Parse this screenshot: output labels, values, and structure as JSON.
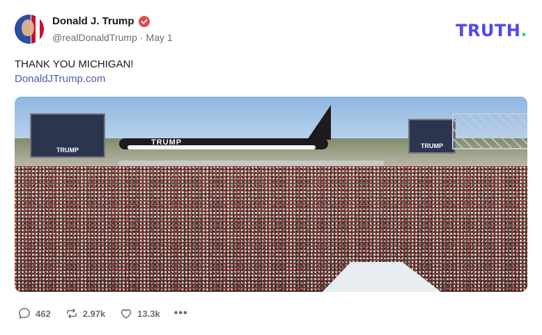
{
  "author": {
    "name": "Donald J. Trump",
    "handle": "@realDonaldTrump",
    "separator": "·",
    "date": "May 1"
  },
  "brand": {
    "text": "TRUTH",
    "dot": ".",
    "color": "#5448ee",
    "dot_color": "#1fd3a8"
  },
  "post": {
    "text": "THANK YOU MICHIGAN!",
    "link_text": "DonaldJTrump.com"
  },
  "media": {
    "plane_label": "TRUMP",
    "screen_label_left": "TRUMP",
    "screen_label_right": "TRUMP"
  },
  "actions": {
    "replies": "462",
    "retruths": "2.97k",
    "likes": "13.3k",
    "more": "•••"
  }
}
